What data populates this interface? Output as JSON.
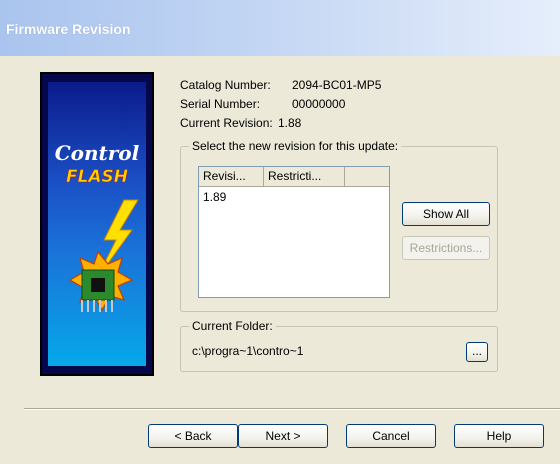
{
  "window": {
    "title": "Firmware Revision"
  },
  "logo": {
    "line1": "Control",
    "line2": "FLASH"
  },
  "info": {
    "catalog_label": "Catalog Number:",
    "catalog_value": "2094-BC01-MP5",
    "serial_label": "Serial Number:",
    "serial_value": "00000000",
    "revision_label": "Current Revision:",
    "revision_value": "1.88"
  },
  "revision_group": {
    "legend": "Select the new revision for this update:",
    "columns": [
      "Revisi...",
      "Restricti..."
    ],
    "rows": [
      {
        "revision": "1.89",
        "restriction": ""
      }
    ],
    "show_all_label": "Show All",
    "restrictions_label": "Restrictions..."
  },
  "folder_group": {
    "legend": "Current Folder:",
    "path": "c:\\progra~1\\contro~1",
    "browse_label": "..."
  },
  "footer": {
    "back_label": "< Back",
    "next_label": "Next >",
    "cancel_label": "Cancel",
    "help_label": "Help"
  },
  "colors": {
    "title_gradient_start": "#a9c4ee",
    "dialog_bg": "#ece9d8",
    "logo_bg": "#04074a"
  }
}
